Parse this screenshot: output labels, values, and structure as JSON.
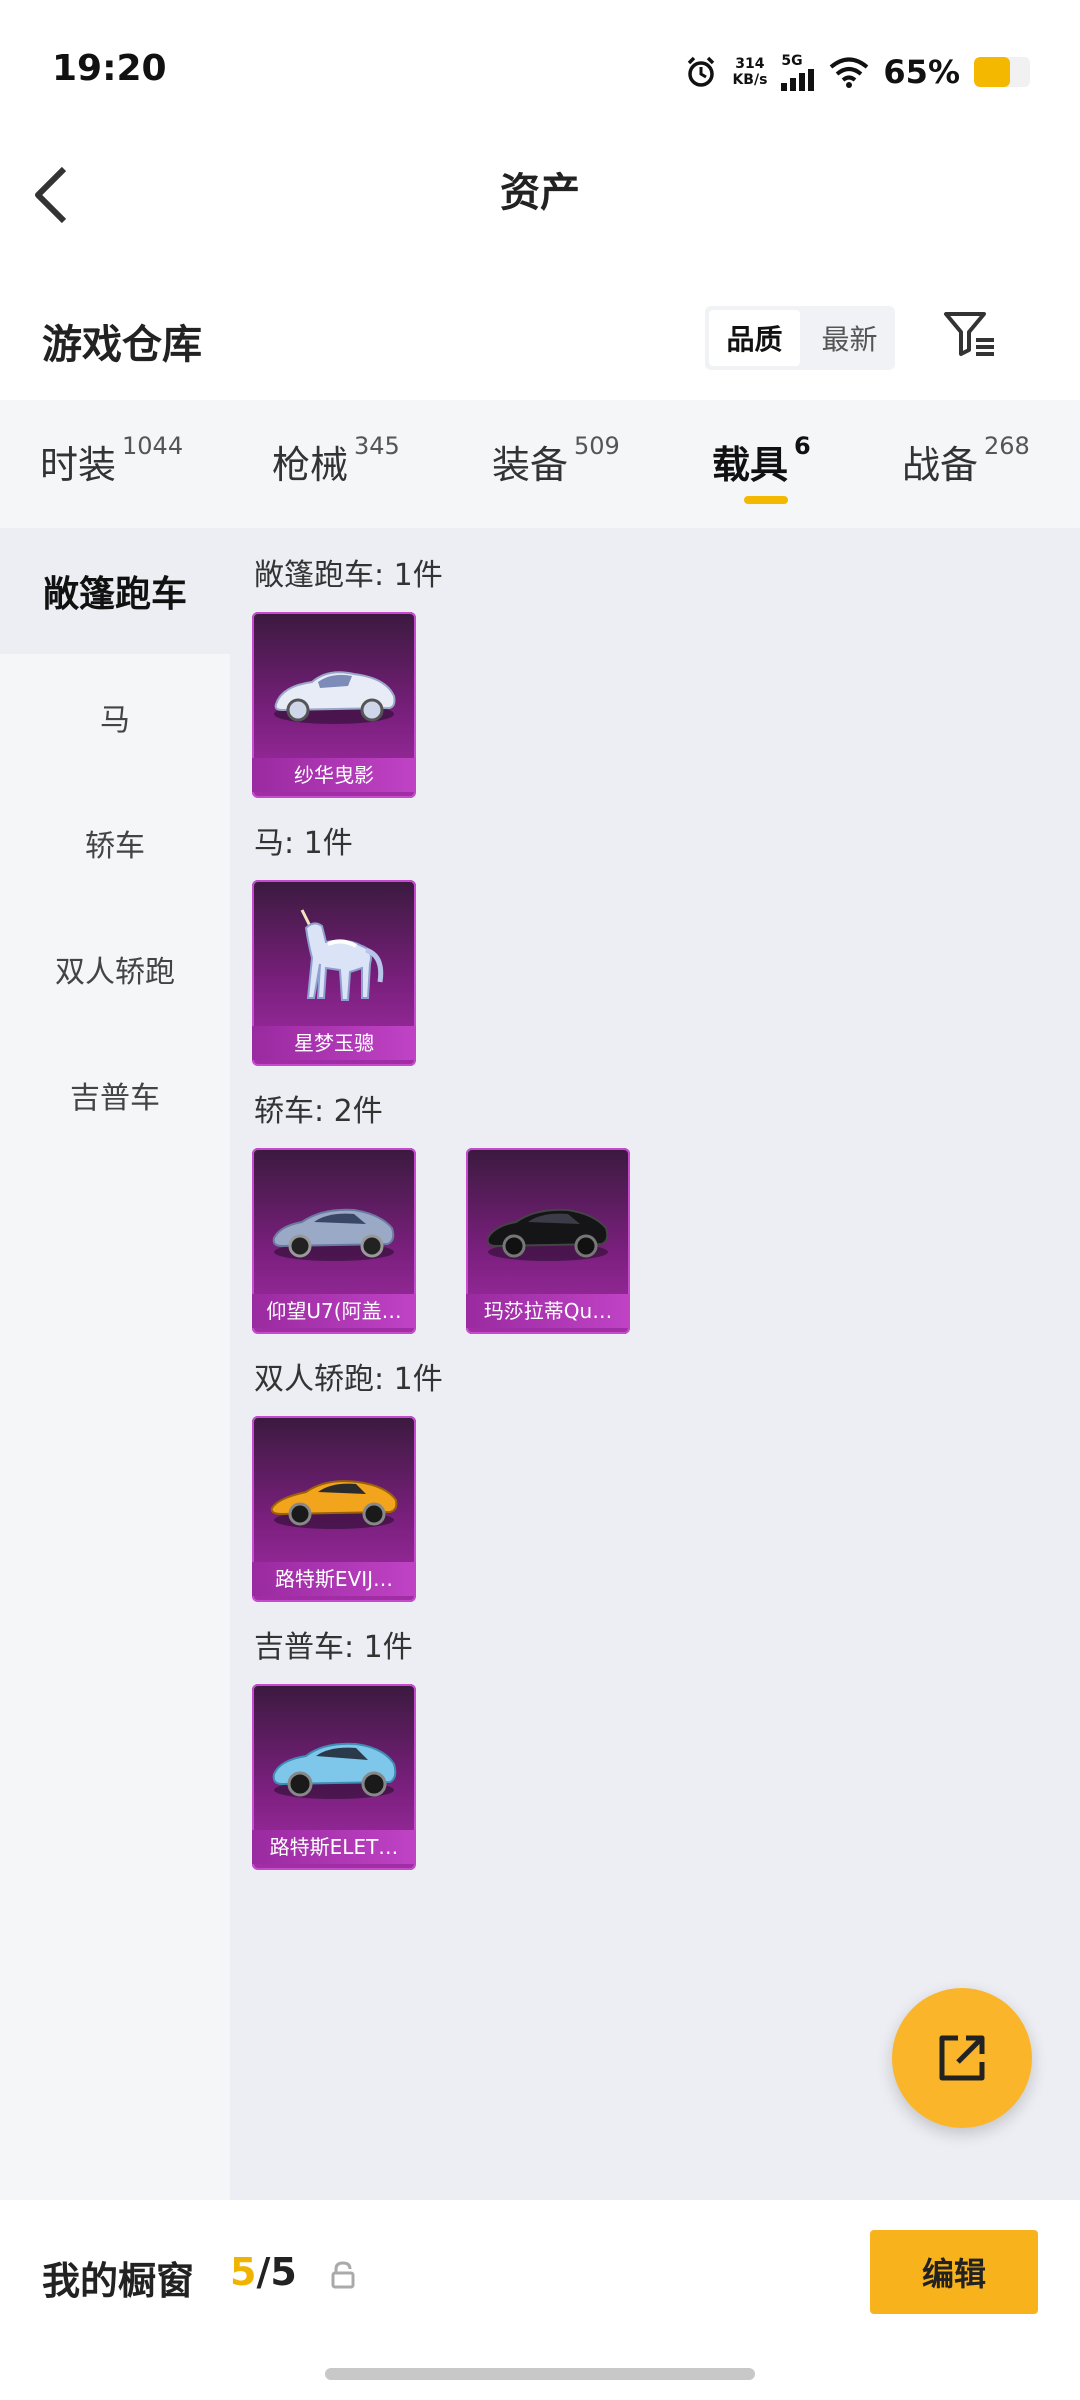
{
  "status": {
    "time": "19:20",
    "net_speed_value": "314",
    "net_speed_unit": "KB/s",
    "signal": "5G",
    "battery_text": "65%",
    "battery_level": 0.65
  },
  "header": {
    "title": "资产"
  },
  "warehouse": {
    "title": "游戏仓库",
    "sort_options": [
      "品质",
      "最新"
    ],
    "sort_selected": "品质"
  },
  "tabs": [
    {
      "label": "时装",
      "count": "1044"
    },
    {
      "label": "枪械",
      "count": "345"
    },
    {
      "label": "装备",
      "count": "509"
    },
    {
      "label": "载具",
      "count": "6",
      "active": true
    },
    {
      "label": "战备",
      "count": "268"
    }
  ],
  "sidebar": {
    "items": [
      "敞篷跑车",
      "马",
      "轿车",
      "双人轿跑",
      "吉普车"
    ],
    "active": "敞篷跑车"
  },
  "groups": [
    {
      "title": "敞篷跑车: 1件",
      "items": [
        {
          "name": "纱华曳影",
          "icon": "convertible-car-icon"
        }
      ]
    },
    {
      "title": "马: 1件",
      "items": [
        {
          "name": "星梦玉骢",
          "icon": "unicorn-horse-icon"
        }
      ]
    },
    {
      "title": "轿车: 2件",
      "items": [
        {
          "name": "仰望U7(阿盖…",
          "icon": "sedan-car-icon"
        },
        {
          "name": "玛莎拉蒂Qu…",
          "icon": "sedan-car-icon"
        }
      ]
    },
    {
      "title": "双人轿跑: 1件",
      "items": [
        {
          "name": "路特斯EVIJ…",
          "icon": "sports-car-icon"
        }
      ]
    },
    {
      "title": "吉普车: 1件",
      "items": [
        {
          "name": "路特斯ELET…",
          "icon": "suv-car-icon"
        }
      ]
    }
  ],
  "bottom": {
    "showcase_label": "我的橱窗",
    "showcase_current": "5",
    "showcase_sep": "/",
    "showcase_total": "5",
    "edit_label": "编辑"
  },
  "colors": {
    "accent": "#f5b800",
    "card_purple": "#a32ea6",
    "fab": "#fab52a"
  }
}
